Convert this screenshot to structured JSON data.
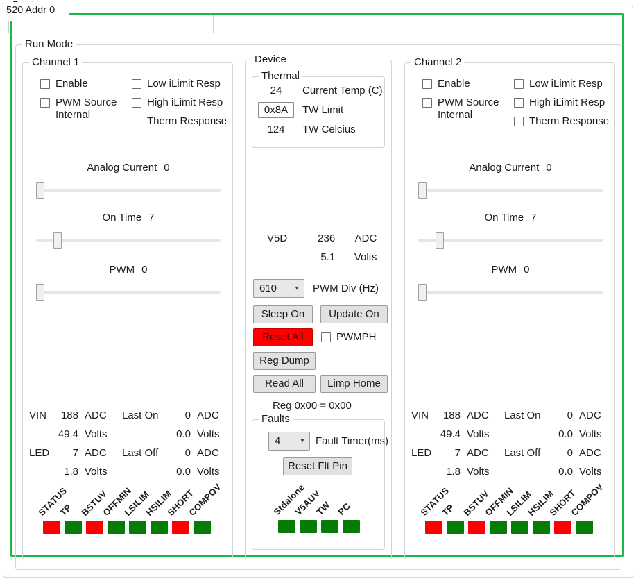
{
  "window": {
    "devices_group_label": "Devices",
    "run_mode_label": "Run Mode",
    "accent_color": "#18b84a"
  },
  "tabs": {
    "items": [
      {
        "label": "520 Addr 0",
        "selected": true
      }
    ]
  },
  "channel1": {
    "title": "Channel 1",
    "checkboxes": [
      {
        "label": "Enable",
        "label2": "",
        "checked": false
      },
      {
        "label": "PWM Source",
        "label2": "Internal",
        "checked": false
      },
      {
        "label": "Low iLimit Resp",
        "label2": "",
        "checked": false
      },
      {
        "label": "High iLimit Resp",
        "label2": "",
        "checked": false
      },
      {
        "label": "Therm Response",
        "label2": "",
        "checked": false
      }
    ],
    "sliders": [
      {
        "name": "Analog Current",
        "value": "0",
        "pct": 0
      },
      {
        "name": "On Time",
        "value": "7",
        "pct": 10
      },
      {
        "name": "PWM",
        "value": "0",
        "pct": 0
      }
    ],
    "readout": {
      "rows": [
        {
          "label": "VIN",
          "num": "188",
          "unit": "ADC",
          "label2": "Last On",
          "num2": "0",
          "unit2": "ADC"
        },
        {
          "label": "",
          "num": "49.4",
          "unit": "Volts",
          "label2": "",
          "num2": "0.0",
          "unit2": "Volts"
        },
        {
          "label": "LED",
          "num": "7",
          "unit": "ADC",
          "label2": "Last Off",
          "num2": "0",
          "unit2": "ADC"
        },
        {
          "label": "",
          "num": "1.8",
          "unit": "Volts",
          "label2": "",
          "num2": "0.0",
          "unit2": "Volts"
        }
      ]
    },
    "status_leds": [
      {
        "label": "STATUS",
        "state": "red"
      },
      {
        "label": "TP",
        "state": "green"
      },
      {
        "label": "BSTUV",
        "state": "red"
      },
      {
        "label": "OFFMIN",
        "state": "green"
      },
      {
        "label": "LSILIM",
        "state": "green"
      },
      {
        "label": "HSILIM",
        "state": "green"
      },
      {
        "label": "SHORT",
        "state": "red"
      },
      {
        "label": "COMPOV",
        "state": "green"
      }
    ]
  },
  "channel2": {
    "title": "Channel 2",
    "checkboxes": [
      {
        "label": "Enable",
        "label2": "",
        "checked": false
      },
      {
        "label": "PWM Source",
        "label2": "Internal",
        "checked": false
      },
      {
        "label": "Low iLimit Resp",
        "label2": "",
        "checked": false
      },
      {
        "label": "High iLimit Resp",
        "label2": "",
        "checked": false
      },
      {
        "label": "Therm Response",
        "label2": "",
        "checked": false
      }
    ],
    "sliders": [
      {
        "name": "Analog Current",
        "value": "0",
        "pct": 0
      },
      {
        "name": "On Time",
        "value": "7",
        "pct": 10
      },
      {
        "name": "PWM",
        "value": "0",
        "pct": 0
      }
    ],
    "readout": {
      "rows": [
        {
          "label": "VIN",
          "num": "188",
          "unit": "ADC",
          "label2": "Last On",
          "num2": "0",
          "unit2": "ADC"
        },
        {
          "label": "",
          "num": "49.4",
          "unit": "Volts",
          "label2": "",
          "num2": "0.0",
          "unit2": "Volts"
        },
        {
          "label": "LED",
          "num": "7",
          "unit": "ADC",
          "label2": "Last Off",
          "num2": "0",
          "unit2": "ADC"
        },
        {
          "label": "",
          "num": "1.8",
          "unit": "Volts",
          "label2": "",
          "num2": "0.0",
          "unit2": "Volts"
        }
      ]
    },
    "status_leds": [
      {
        "label": "STATUS",
        "state": "red"
      },
      {
        "label": "TP",
        "state": "green"
      },
      {
        "label": "BSTUV",
        "state": "red"
      },
      {
        "label": "OFFMIN",
        "state": "green"
      },
      {
        "label": "LSILIM",
        "state": "green"
      },
      {
        "label": "HSILIM",
        "state": "green"
      },
      {
        "label": "SHORT",
        "state": "red"
      },
      {
        "label": "COMPOV",
        "state": "green"
      }
    ]
  },
  "device": {
    "title": "Device",
    "thermal": {
      "title": "Thermal",
      "current_temp_value": "24",
      "current_temp_label": "Current Temp (C)",
      "tw_limit_value": "0x8A",
      "tw_limit_label": "TW Limit",
      "tw_celcius_value": "124",
      "tw_celcius_label": "TW Celcius"
    },
    "v5d": {
      "name": "V5D",
      "adc_value": "236",
      "adc_unit": "ADC",
      "volts_value": "5.1",
      "volts_unit": "Volts"
    },
    "pwm_div": {
      "value": "610",
      "label": "PWM Div (Hz)",
      "options": [
        "610"
      ]
    },
    "buttons": {
      "sleep_on": "Sleep On",
      "update_on": "Update On",
      "reset_all": "Reset All",
      "reg_dump": "Reg Dump",
      "read_all": "Read All",
      "limp_home": "Limp Home"
    },
    "pwmph_checkbox": {
      "label": "PWMPH",
      "checked": false
    },
    "reg_status": "Reg 0x00 = 0x00",
    "faults": {
      "title": "Faults",
      "fault_timer": {
        "value": "4",
        "label": "Fault Timer(ms)",
        "options": [
          "4"
        ]
      },
      "reset_flt_pin": "Reset Flt Pin",
      "leds": [
        {
          "label": "Stdalone",
          "state": "green"
        },
        {
          "label": "V5AUV",
          "state": "green"
        },
        {
          "label": "TW",
          "state": "green"
        },
        {
          "label": "PC",
          "state": "green"
        }
      ]
    }
  },
  "colors": {
    "led_red": "#fe0000",
    "led_green": "#067c07"
  }
}
